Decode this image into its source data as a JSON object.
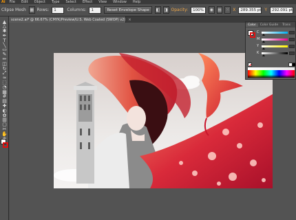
{
  "menubar": {
    "items": [
      "File",
      "Edit",
      "Object",
      "Type",
      "Select",
      "Effect",
      "View",
      "Window",
      "Help"
    ],
    "logo": "Ai"
  },
  "controlbar": {
    "tool_name": "Clipse Mesh",
    "rows_label": "Rows:",
    "rows_value": "1",
    "columns_label": "Columns:",
    "columns_value": "1",
    "reset_button": "Reset Envelope Shape",
    "opacity_label": "Opacity:",
    "opacity_value": "100%",
    "x_value": "289.355 pt",
    "y_value": "292.091 pt"
  },
  "document": {
    "tab_title": "scene2.ai* @ 66.67% (CMYK/Preview/U.S. Web Coated (SWOP) v2)",
    "close_glyph": "×"
  },
  "color_panel": {
    "tabs": [
      "Color",
      "Color Guide",
      "Trans"
    ],
    "channels": [
      "C",
      "M",
      "Y",
      "K"
    ],
    "colors": {
      "C": "#00aeef",
      "M": "#ec008c",
      "Y": "#fff200",
      "K": "#000000"
    }
  },
  "tools": {
    "icons": [
      "selection-icon",
      "direct-selection-icon",
      "magic-wand-icon",
      "pen-icon",
      "type-icon",
      "line-icon",
      "rectangle-icon",
      "brush-icon",
      "pencil-icon",
      "eraser-icon",
      "rotate-icon",
      "scale-icon",
      "warp-icon",
      "free-transform-icon",
      "shape-builder-icon",
      "perspective-icon",
      "mesh-icon",
      "gradient-icon",
      "eyedropper-icon",
      "blend-icon",
      "symbol-sprayer-icon",
      "graph-icon",
      "artboard-icon",
      "slice-icon",
      "hand-icon",
      "zoom-icon"
    ],
    "glyphs": [
      "▲",
      "△",
      "✱",
      "✒",
      "T",
      "╲",
      "▭",
      "✎",
      "✏",
      "◫",
      "↻",
      "⤢",
      "≈",
      "⬚",
      "◔",
      "▦",
      "#",
      "▤",
      "✚",
      "◐",
      "✿",
      "▥",
      "▢",
      "✂",
      "✋",
      "⊕"
    ]
  },
  "accent": "#c81e2a"
}
